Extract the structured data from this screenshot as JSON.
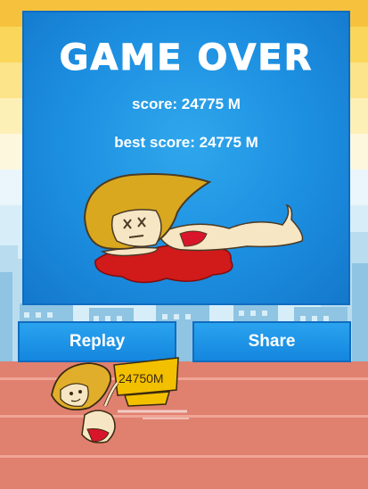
{
  "screen": {
    "title": "GAME OVER",
    "score_text": "score: 24775 M",
    "best_score_text": "best score: 24775 M"
  },
  "buttons": {
    "replay_label": "Replay",
    "share_label": "Share"
  },
  "runner": {
    "distance_sign": "24750M"
  },
  "colors": {
    "panel_blue": "#1c8ee0",
    "button_blue": "#1f95e8",
    "ground": "#e0806f",
    "sky_top": "#f6c23e"
  }
}
